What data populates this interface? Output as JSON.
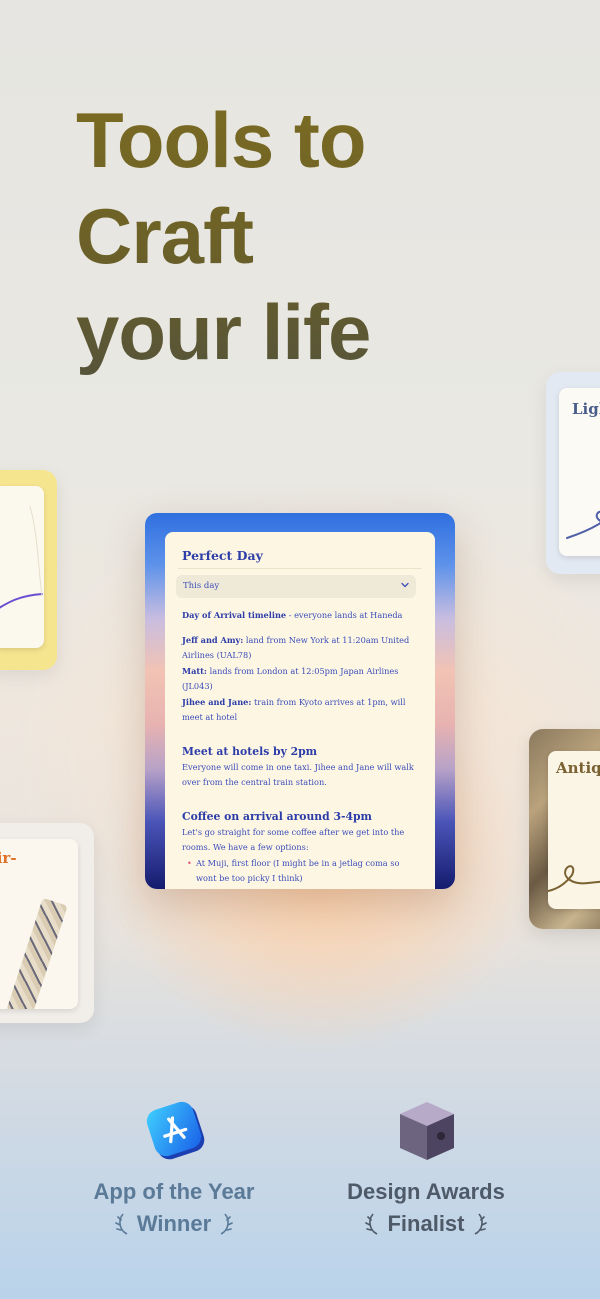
{
  "headline": {
    "lines": [
      "Tools to",
      "Craft",
      "your life"
    ]
  },
  "side_cards": {
    "left_bottom_label": "voir-\nre",
    "right_top_label": "Ligh",
    "right_bottom_label": "Antiq"
  },
  "document": {
    "title": "Perfect Day",
    "dropdown_value": "This day",
    "intro_bold": "Day of Arrival timeline",
    "intro_text": " - everyone lands at Haneda",
    "arrivals": [
      {
        "name": "Jeff and Amy:",
        "text": " land from New York at 11:20am United Airlines (UAL78)"
      },
      {
        "name": "Matt:",
        "text": " lands from London at 12:05pm Japan Airlines (JL043)"
      },
      {
        "name": "Jihee and Jane:",
        "text": " train from Kyoto arrives at 1pm, will meet at hotel"
      }
    ],
    "section1_heading": "Meet at hotels by 2pm",
    "section1_text": "Everyone will come in one taxi. Jihee and Jane will walk over from the central train station.",
    "section2_heading": "Coffee on arrival around 3-4pm",
    "section2_text": "Let's go straight for some coffee after we get into the rooms. We have a few options:",
    "section2_bullets": [
      "At Muji, first floor (I might be in a jetlag coma so wont be too picky I think)"
    ]
  },
  "awards": [
    {
      "title": "App of the Year",
      "subtitle": "Winner",
      "icon": "app-store-icon"
    },
    {
      "title": "Design Awards",
      "subtitle": "Finalist",
      "icon": "apple-design-award-cube-icon"
    }
  ],
  "colors": {
    "headline": "#6b6028",
    "doc_text": "#3447b8",
    "accent_orange": "#e07126"
  }
}
